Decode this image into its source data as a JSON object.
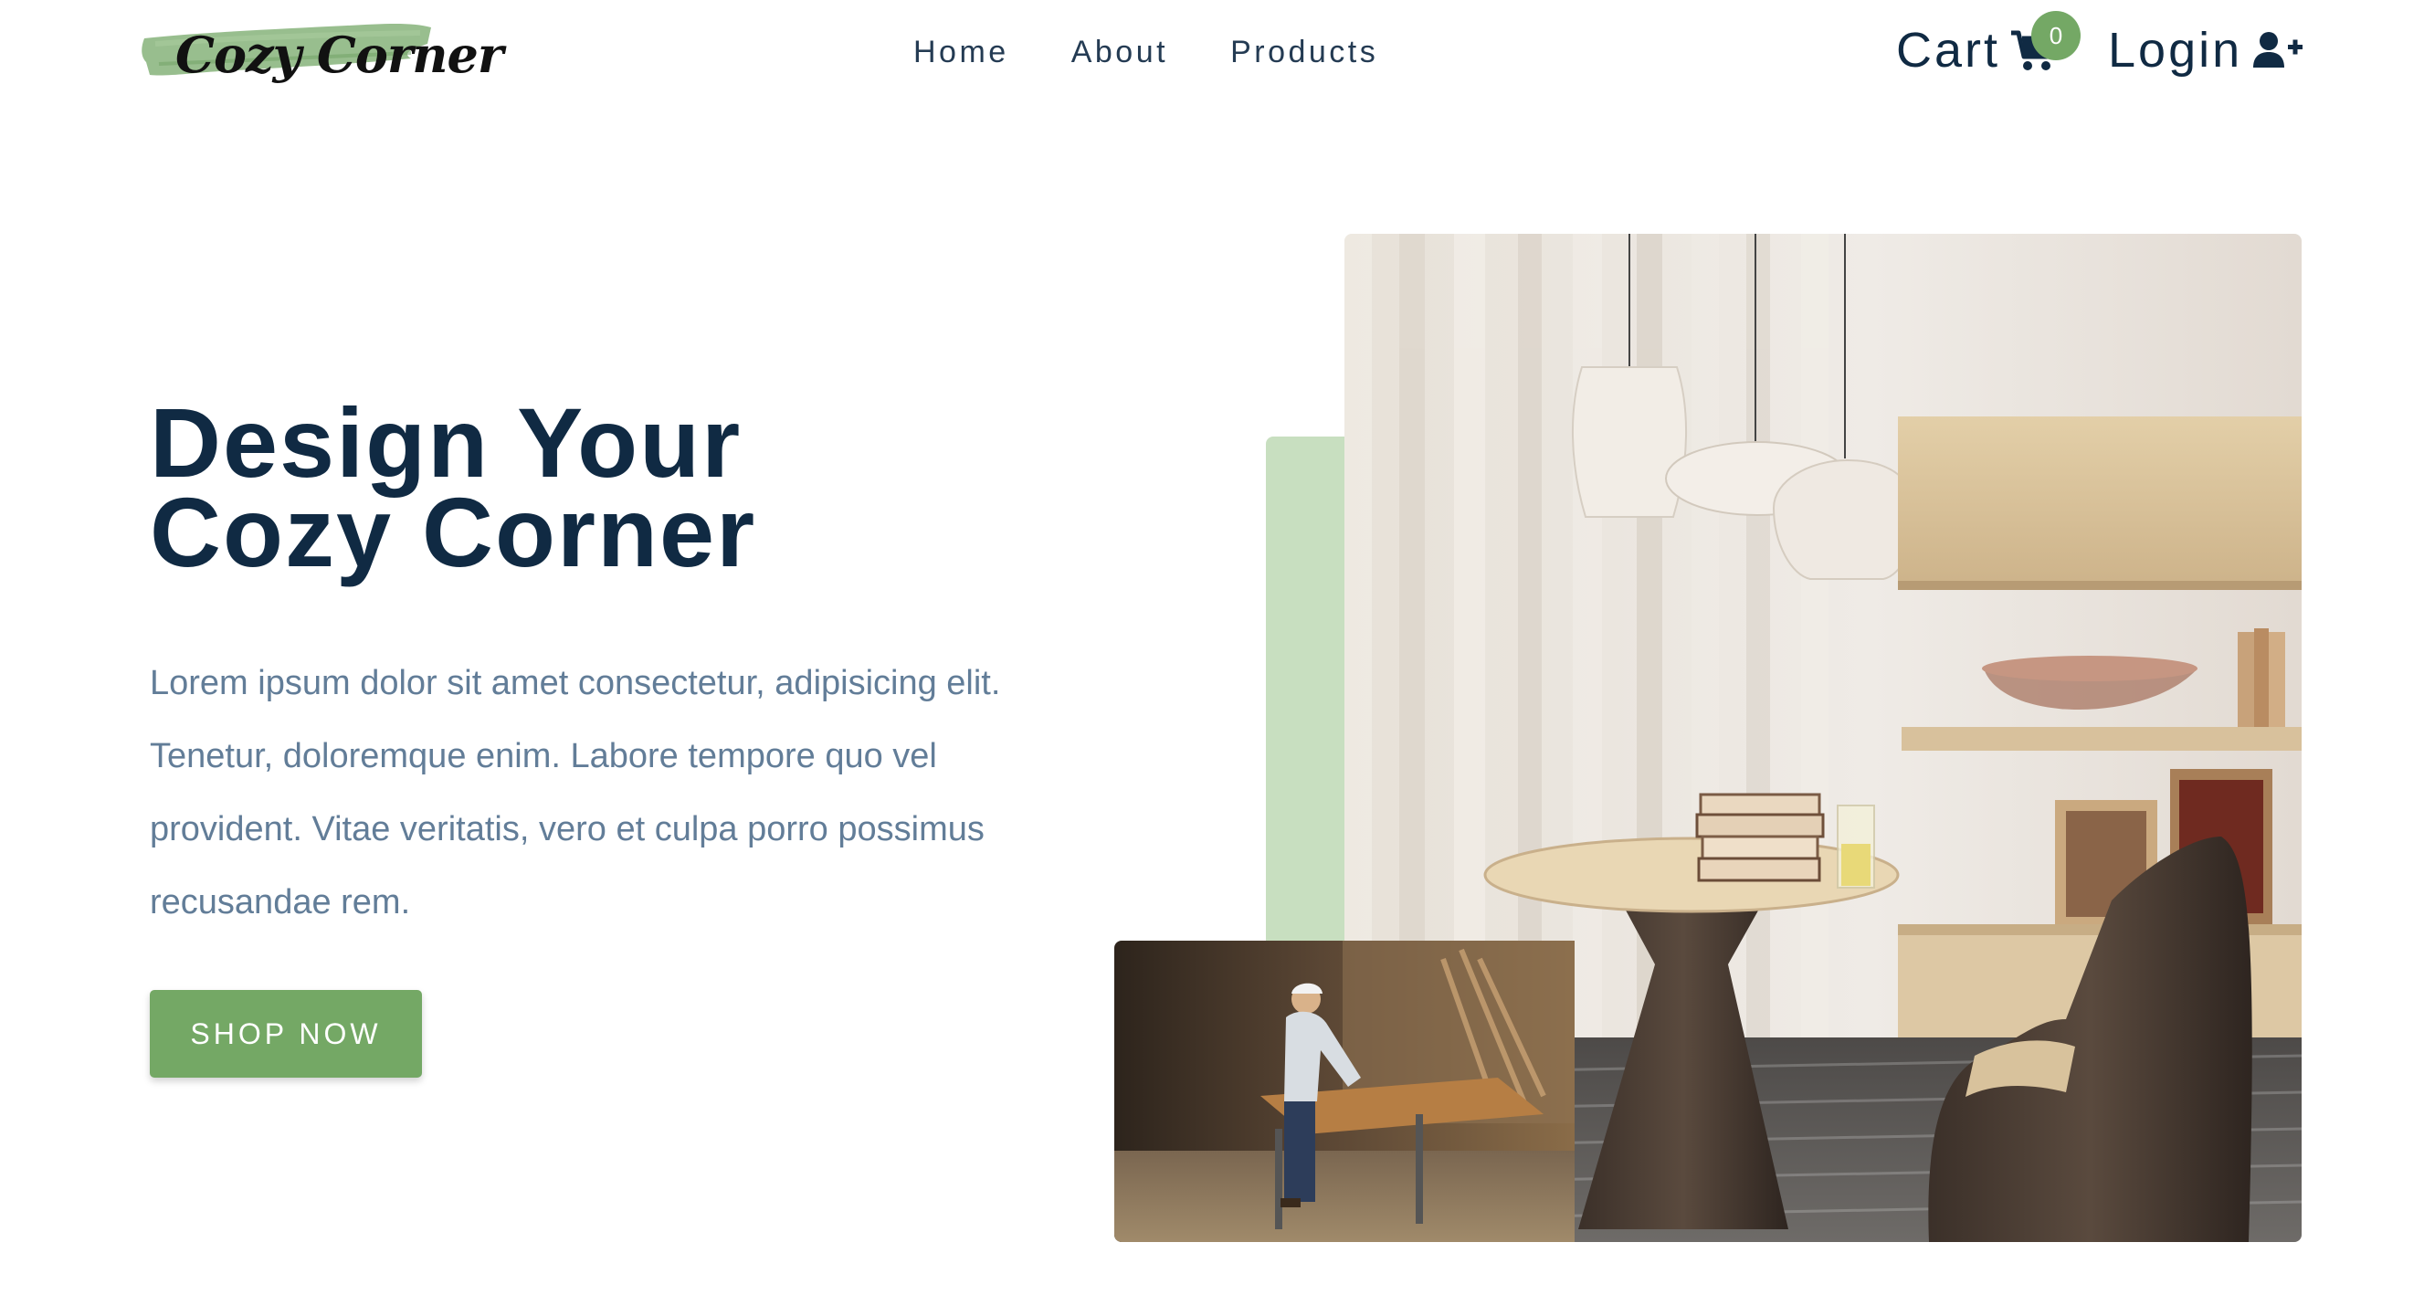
{
  "header": {
    "logo_text": "Cozy Corner",
    "nav": [
      {
        "label": "Home"
      },
      {
        "label": "About"
      },
      {
        "label": "Products"
      }
    ],
    "cart": {
      "label": "Cart",
      "count": "0",
      "icon": "cart-icon"
    },
    "login": {
      "label": "Login",
      "icon": "user-plus-icon"
    }
  },
  "hero": {
    "title_line1": "Design Your",
    "title_line2": "Cozy Corner",
    "description": "Lorem ipsum dolor sit amet consectetur, adipisicing elit. Tenetur, doloremque enim. Labore tempore quo vel provident. Vitae veritatis, vero et culpa porro possimus recusandae rem.",
    "cta": "SHOP NOW"
  },
  "colors": {
    "primary": "#74a865",
    "primary_light": "#c8dfc0",
    "heading": "#102a43",
    "text": "#627d98"
  }
}
